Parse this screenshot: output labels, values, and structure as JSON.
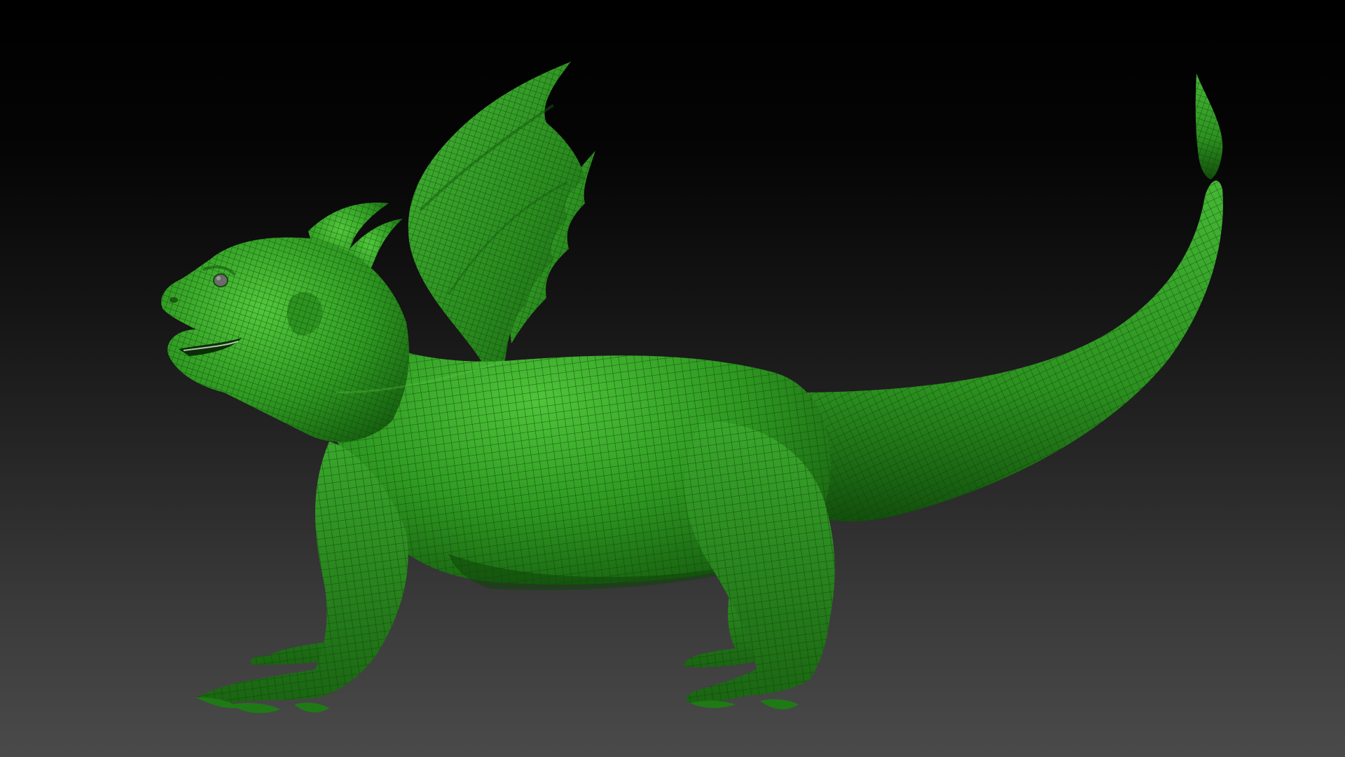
{
  "viewport": {
    "background_top": "#000000",
    "background_bottom": "#4a4a4a"
  },
  "model": {
    "subject": "dragon",
    "display_mode": "polyframe-wireframe",
    "material_color": "#2f9a22",
    "material_highlight": "#4ec43a",
    "material_shadow": "#0f4a0a",
    "wire_color": "#0d3a08",
    "eye_color": "#6b6b6b"
  }
}
